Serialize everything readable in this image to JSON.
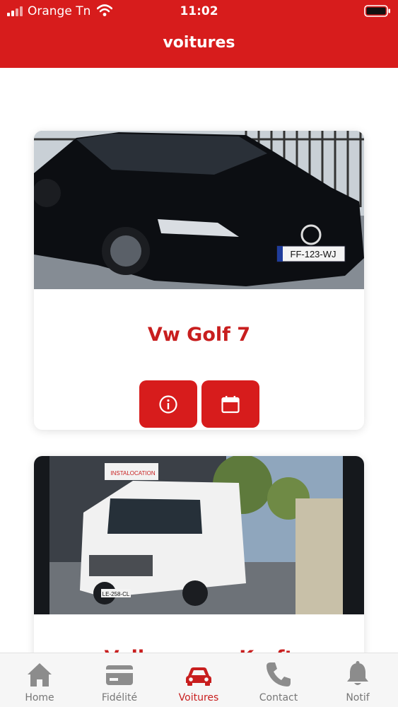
{
  "status_bar": {
    "carrier": "Orange Tn",
    "time": "11:02"
  },
  "header": {
    "title": "voitures"
  },
  "cars": [
    {
      "name": "Vw Golf 7",
      "plate": "FF-123-WJ",
      "buttons": [
        "info-icon",
        "calendar-icon"
      ]
    },
    {
      "name": "Volkswagen Kraft",
      "plate": "LE-258-CL",
      "sign": "INSTALOCATION"
    }
  ],
  "bottom_nav": {
    "active": "Voitures",
    "items": [
      {
        "label": "Home",
        "icon": "home-icon"
      },
      {
        "label": "Fidélité",
        "icon": "card-icon"
      },
      {
        "label": "Voitures",
        "icon": "car-icon"
      },
      {
        "label": "Contact",
        "icon": "phone-icon"
      },
      {
        "label": "Notif",
        "icon": "bell-icon"
      }
    ]
  },
  "colors": {
    "primary": "#d71c1c",
    "active_text": "#c81e1e",
    "inactive": "#777777"
  }
}
